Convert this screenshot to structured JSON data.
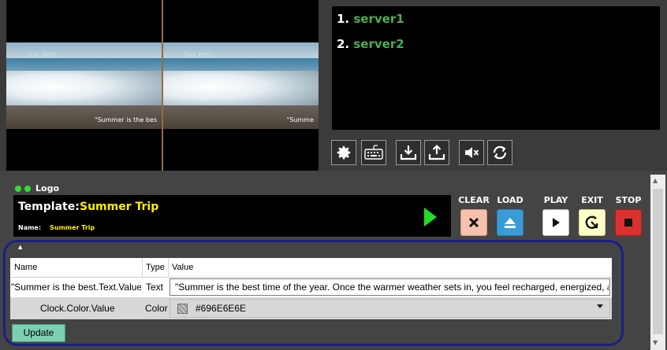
{
  "previews": [
    {
      "caption": "\"Summer is the bes",
      "watermark": "THE BEST"
    },
    {
      "caption": "\"Summe",
      "watermark": "THE BEST"
    }
  ],
  "servers": [
    {
      "number": "1.",
      "name": "server1"
    },
    {
      "number": "2.",
      "name": "server2"
    }
  ],
  "toolbar": [
    {
      "name": "settings-button",
      "icon": "gear-icon"
    },
    {
      "name": "keyboard-button",
      "icon": "keyboard-icon"
    },
    {
      "name": "import-button",
      "icon": "download-icon"
    },
    {
      "name": "export-button",
      "icon": "upload-icon"
    },
    {
      "name": "mute-button",
      "icon": "mute-icon"
    },
    {
      "name": "refresh-button",
      "icon": "refresh-icon"
    }
  ],
  "layer": {
    "label": "Logo",
    "status_color": "#33dd33"
  },
  "template": {
    "key": "Template:",
    "value": "Summer Trip",
    "name_key": "Name:",
    "name_value": "Summer Trip"
  },
  "controls": {
    "clear": "CLEAR",
    "load": "LOAD",
    "play": "PLAY",
    "exit": "EXIT",
    "stop": "STOP"
  },
  "properties": {
    "headers": {
      "name": "Name",
      "type": "Type",
      "value": "Value"
    },
    "rows": [
      {
        "name": "\"Summer is the best.Text.Value",
        "type": "Text",
        "value": "\"Summer is the best time of the year. Once the warmer weather sets in, you feel recharged, energized, a"
      },
      {
        "name": "Clock.Color.Value",
        "type": "Color",
        "value": "#696E6E6E"
      }
    ]
  },
  "update_label": "Update"
}
